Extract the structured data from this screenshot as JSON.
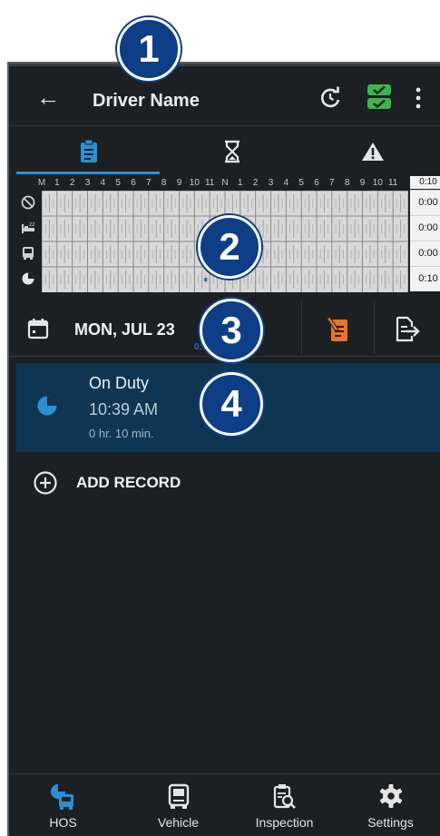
{
  "header": {
    "title": "Driver Name"
  },
  "tabs": [
    {
      "name": "logs",
      "icon": "clipboard-icon",
      "active": true
    },
    {
      "name": "timers",
      "icon": "hourglass-icon",
      "active": false
    },
    {
      "name": "violations",
      "icon": "warning-icon",
      "active": false
    }
  ],
  "log_grid": {
    "hours": [
      "M",
      "1",
      "2",
      "3",
      "4",
      "5",
      "6",
      "7",
      "8",
      "9",
      "10",
      "11",
      "N",
      "1",
      "2",
      "3",
      "4",
      "5",
      "6",
      "7",
      "8",
      "9",
      "10",
      "11"
    ],
    "total_header": "0:10",
    "rows": [
      {
        "status": "off-duty",
        "icon": "off-duty-icon",
        "total": "0:00"
      },
      {
        "status": "sleeper",
        "icon": "sleeper-berth-icon",
        "total": "0:00"
      },
      {
        "status": "driving",
        "icon": "truck-front-icon",
        "total": "0:00"
      },
      {
        "status": "on-duty",
        "icon": "on-duty-clock-icon",
        "total": "0:10"
      }
    ],
    "on_duty_annotation": "0:10"
  },
  "date_bar": {
    "date": "MON, JUL 23"
  },
  "record": {
    "status": "On Duty",
    "time": "10:39 AM",
    "duration": "0 hr. 10 min."
  },
  "add_record": {
    "label": "ADD RECORD"
  },
  "bottom_nav": [
    {
      "label": "HOS",
      "icon": "hos-icon"
    },
    {
      "label": "Vehicle",
      "icon": "vehicle-icon"
    },
    {
      "label": "Inspection",
      "icon": "inspection-icon"
    },
    {
      "label": "Settings",
      "icon": "gear-icon"
    }
  ],
  "callouts": [
    "1",
    "2",
    "3",
    "4"
  ],
  "colors": {
    "accent": "#2b8fd4",
    "record_bg": "#103552",
    "edit_orange": "#e8732c",
    "check_green": "#3bb54a",
    "callout_blue": "#0d3e86"
  }
}
